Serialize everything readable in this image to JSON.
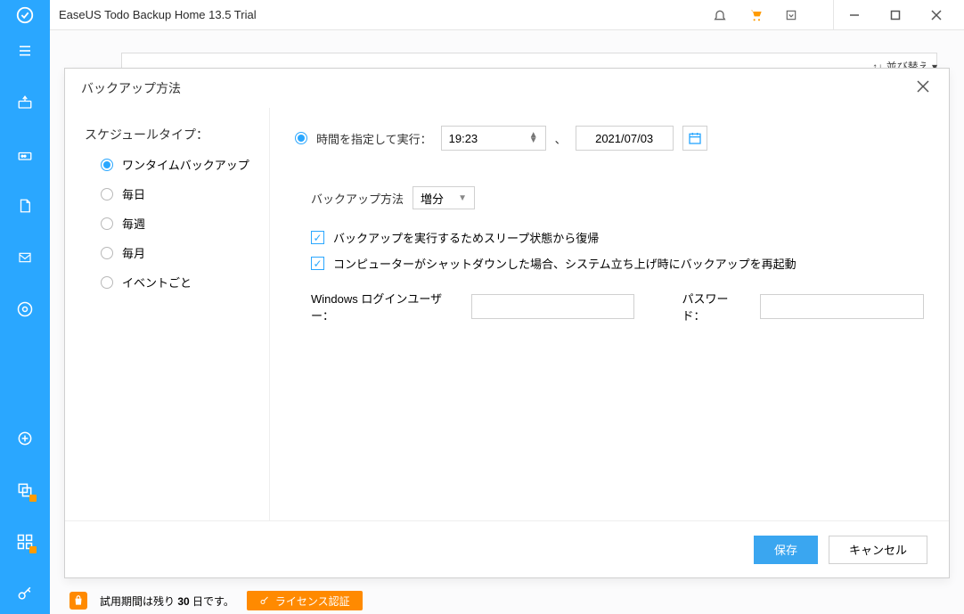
{
  "title": "EaseUS Todo Backup Home 13.5 Trial",
  "sort_label": "並び替え",
  "dialog": {
    "title": "バックアップ方法",
    "schedule_type_label": "スケジュールタイプ：",
    "schedule_options": {
      "onetime": "ワンタイムバックアップ",
      "daily": "毎日",
      "weekly": "毎週",
      "monthly": "毎月",
      "event": "イベントごと"
    },
    "time_execute_label": "時間を指定して実行：",
    "time_value": "19:23",
    "date_sep": "、",
    "date_value": "2021/07/03",
    "method_label": "バックアップ方法",
    "method_value": "増分",
    "check_wake": "バックアップを実行するためスリープ状態から復帰",
    "check_restart": "コンピューターがシャットダウンした場合、システム立ち上げ時にバックアップを再起動",
    "win_user_label": "Windows ログインユーザー：",
    "password_label": "パスワード：",
    "save_btn": "保存",
    "cancel_btn": "キャンセル"
  },
  "trial": {
    "text_pre": "試用期間は残り ",
    "days": "30",
    "text_post": " 日です。",
    "activate": "ライセンス認証"
  }
}
